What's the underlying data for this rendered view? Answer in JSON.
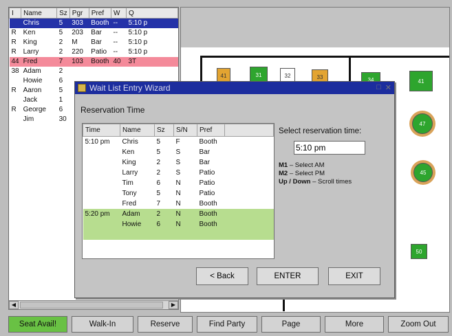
{
  "waitlist": {
    "columns": [
      "I",
      "Name",
      "Sz",
      "Pgr",
      "Pref",
      "W",
      "Q"
    ],
    "rows": [
      {
        "i": "",
        "name": "Chris",
        "sz": "5",
        "pgr": "303",
        "pref": "Booth",
        "w": "--",
        "q": "5:10 p",
        "state": "selected"
      },
      {
        "i": "R",
        "name": "Ken",
        "sz": "5",
        "pgr": "203",
        "pref": "Bar",
        "w": "--",
        "q": "5:10 p",
        "state": ""
      },
      {
        "i": "R",
        "name": "King",
        "sz": "2",
        "pgr": "M",
        "pref": "Bar",
        "w": "--",
        "q": "5:10 p",
        "state": ""
      },
      {
        "i": "R",
        "name": "Larry",
        "sz": "2",
        "pgr": "220",
        "pref": "Patio",
        "w": "--",
        "q": "5:10 p",
        "state": ""
      },
      {
        "i": "44",
        "name": "Fred",
        "sz": "7",
        "pgr": "103",
        "pref": "Booth",
        "w": "40",
        "q": "3T",
        "state": "alert"
      },
      {
        "i": "38",
        "name": "Adam",
        "sz": "2",
        "pgr": "",
        "pref": "",
        "w": "",
        "q": "",
        "state": ""
      },
      {
        "i": "",
        "name": "Howie",
        "sz": "6",
        "pgr": "",
        "pref": "",
        "w": "",
        "q": "",
        "state": ""
      },
      {
        "i": "R",
        "name": "Aaron",
        "sz": "5",
        "pgr": "",
        "pref": "",
        "w": "",
        "q": "",
        "state": ""
      },
      {
        "i": "",
        "name": "Jack",
        "sz": "1",
        "pgr": "",
        "pref": "",
        "w": "",
        "q": "",
        "state": ""
      },
      {
        "i": "R",
        "name": "George",
        "sz": "6",
        "pgr": "",
        "pref": "",
        "w": "",
        "q": "",
        "state": ""
      },
      {
        "i": "",
        "name": "Jim",
        "sz": "30",
        "pgr": "",
        "pref": "",
        "w": "",
        "q": "",
        "state": ""
      }
    ]
  },
  "floor": {
    "tables": [
      "41",
      "31",
      "32",
      "33",
      "34",
      "41",
      "47",
      "45",
      "50"
    ]
  },
  "dialog": {
    "title": "Wait List Entry Wizard",
    "section": "Reservation Time",
    "columns": [
      "Time",
      "Name",
      "Sz",
      "S/N",
      "Pref"
    ],
    "rows": [
      {
        "time": "5:10 pm",
        "name": "Chris",
        "sz": "5",
        "sn": "F",
        "pref": "Booth",
        "green": false
      },
      {
        "time": "",
        "name": "Ken",
        "sz": "5",
        "sn": "S",
        "pref": "Bar",
        "green": false
      },
      {
        "time": "",
        "name": "King",
        "sz": "2",
        "sn": "S",
        "pref": "Bar",
        "green": false
      },
      {
        "time": "",
        "name": "Larry",
        "sz": "2",
        "sn": "S",
        "pref": "Patio",
        "green": false
      },
      {
        "time": "",
        "name": "Tim",
        "sz": "6",
        "sn": "N",
        "pref": "Patio",
        "green": false
      },
      {
        "time": "",
        "name": "Tony",
        "sz": "5",
        "sn": "N",
        "pref": "Patio",
        "green": false
      },
      {
        "time": "",
        "name": "Fred",
        "sz": "7",
        "sn": "N",
        "pref": "Booth",
        "green": false
      },
      {
        "time": "5:20 pm",
        "name": "Adam",
        "sz": "2",
        "sn": "N",
        "pref": "Booth",
        "green": true
      },
      {
        "time": "",
        "name": "Howie",
        "sz": "6",
        "sn": "N",
        "pref": "Booth",
        "green": true
      },
      {
        "time": "",
        "name": "",
        "sz": "",
        "sn": "",
        "pref": "",
        "green": true
      }
    ],
    "select_label": "Select reservation time:",
    "time_value": "5:10 pm",
    "help": [
      {
        "key": "M1",
        "text": "– Select AM"
      },
      {
        "key": "M2",
        "text": "– Select PM"
      },
      {
        "key": "Up / Down",
        "text": "– Scroll times"
      }
    ],
    "buttons": {
      "back": "< Back",
      "enter": "ENTER",
      "exit": "EXIT"
    }
  },
  "toolbar": {
    "seat": "Seat Avail!",
    "walkin": "Walk-In",
    "reserve": "Reserve",
    "find": "Find Party",
    "page": "Page",
    "more": "More",
    "zoom": "Zoom Out"
  }
}
